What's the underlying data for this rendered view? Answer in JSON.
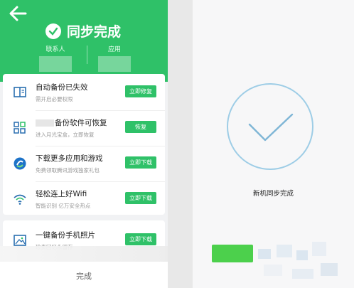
{
  "left": {
    "header": {
      "title": "同步完成",
      "stats": [
        {
          "label": "联系人"
        },
        {
          "label": "应用"
        }
      ]
    },
    "cards": [
      {
        "title": "自动备份已失效",
        "subtitle": "需开启必要权限",
        "button": "立即修复",
        "icon": "book-icon"
      },
      {
        "title": "备份软件可恢复",
        "subtitle": "进入月光宝盒，立即恢复",
        "button": "恢复",
        "icon": "apps-grid-icon"
      },
      {
        "title": "下载更多应用和游戏",
        "subtitle": "免费领取腾讯游戏独家礼包",
        "button": "立即下载",
        "icon": "app-store-icon"
      },
      {
        "title": "轻松连上好Wifi",
        "subtitle": "智能识别 亿万安全热点",
        "button": "立即下载",
        "icon": "wifi-icon"
      }
    ],
    "photo_card": {
      "title": "一键备份手机照片",
      "subtitle": "珍贵回忆永留存",
      "button": "立即下载",
      "icon": "photo-icon"
    },
    "done_label": "完成"
  },
  "right": {
    "caption": "新机同步完成"
  },
  "colors": {
    "brand_green": "#2fc168",
    "check_blue": "#9ecde6"
  }
}
